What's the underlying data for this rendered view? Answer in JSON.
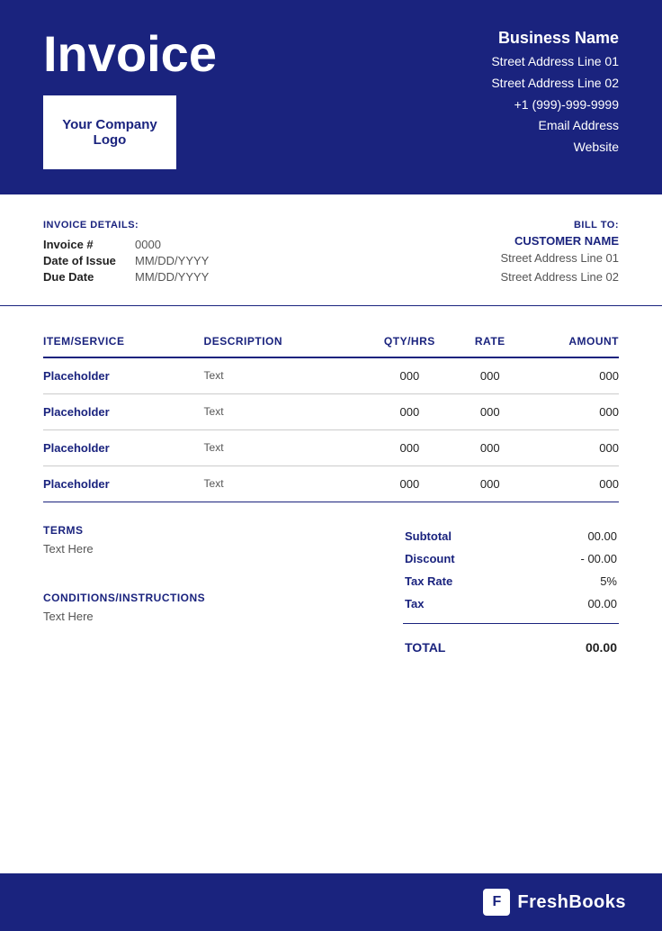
{
  "header": {
    "invoice_title": "Invoice",
    "logo_text": "Your Company Logo",
    "business_name": "Business Name",
    "address_line1": "Street Address Line 01",
    "address_line2": "Street Address Line 02",
    "phone": "+1 (999)-999-9999",
    "email": "Email Address",
    "website": "Website"
  },
  "invoice_details": {
    "section_title": "INVOICE DETAILS:",
    "invoice_label": "Invoice #",
    "invoice_value": "0000",
    "issue_label": "Date of Issue",
    "issue_value": "MM/DD/YYYY",
    "due_label": "Due Date",
    "due_value": "MM/DD/YYYY"
  },
  "bill_to": {
    "section_title": "BILL TO:",
    "customer_name": "CUSTOMER NAME",
    "address_line1": "Street Address Line 01",
    "address_line2": "Street Address Line 02"
  },
  "table": {
    "headers": {
      "item": "ITEM/SERVICE",
      "description": "DESCRIPTION",
      "qty": "QTY/HRS",
      "rate": "RATE",
      "amount": "AMOUNT"
    },
    "rows": [
      {
        "item": "Placeholder",
        "description": "Text",
        "qty": "000",
        "rate": "000",
        "amount": "000"
      },
      {
        "item": "Placeholder",
        "description": "Text",
        "qty": "000",
        "rate": "000",
        "amount": "000"
      },
      {
        "item": "Placeholder",
        "description": "Text",
        "qty": "000",
        "rate": "000",
        "amount": "000"
      },
      {
        "item": "Placeholder",
        "description": "Text",
        "qty": "000",
        "rate": "000",
        "amount": "000"
      }
    ]
  },
  "terms": {
    "title": "TERMS",
    "text": "Text Here"
  },
  "conditions": {
    "title": "CONDITIONS/INSTRUCTIONS",
    "text": "Text Here"
  },
  "totals": {
    "subtotal_label": "Subtotal",
    "subtotal_value": "00.00",
    "discount_label": "Discount",
    "discount_value": "- 00.00",
    "tax_rate_label": "Tax Rate",
    "tax_rate_value": "5%",
    "tax_label": "Tax",
    "tax_value": "00.00",
    "total_label": "TOTAL",
    "total_value": "00.00"
  },
  "footer": {
    "brand_icon": "F",
    "brand_name": "FreshBooks"
  }
}
